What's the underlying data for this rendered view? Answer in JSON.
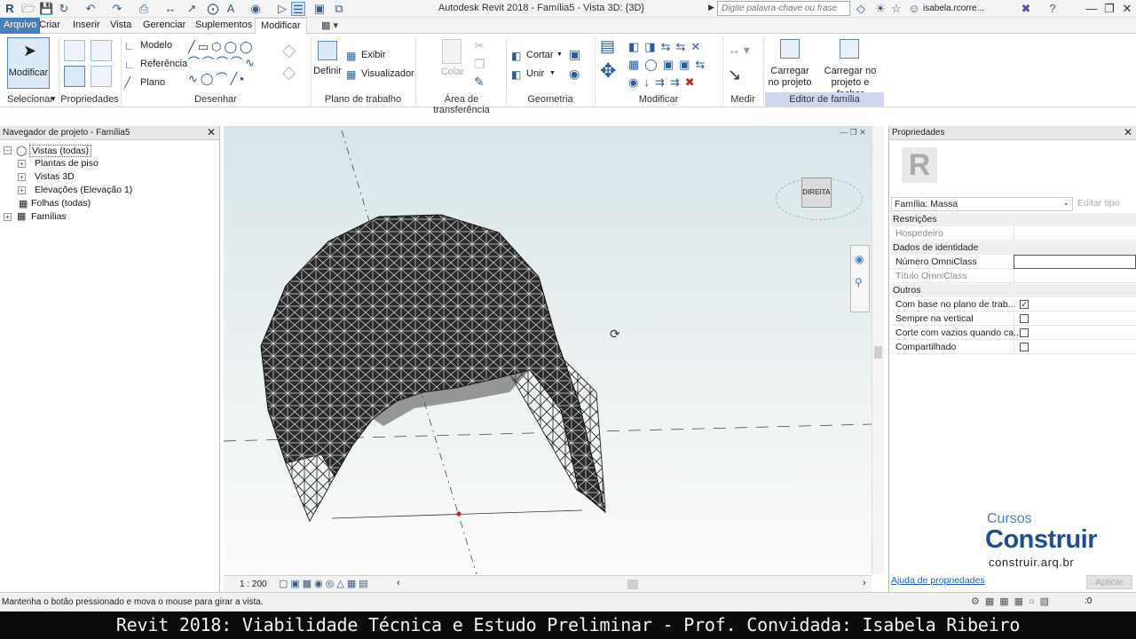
{
  "titlebar": {
    "app_title": "Autodesk Revit 2018 -   Família5 - Vista 3D: {3D}",
    "search_placeholder": "Digite palavra-chave ou frase",
    "user": "isabela.rcorre...",
    "logo": "R"
  },
  "tabs": [
    "Arquivo",
    "Criar",
    "Inserir",
    "Vista",
    "Gerenciar",
    "Suplementos",
    "Modificar"
  ],
  "active_tab": "Modificar",
  "ribbon": {
    "select_panel": {
      "button": "Modificar",
      "label": "Selecionar"
    },
    "properties_panel": {
      "label": "Propriedades"
    },
    "draw_panel": {
      "items": [
        "Modelo",
        "Referência",
        "Plano"
      ],
      "label": "Desenhar"
    },
    "work_plane_panel": {
      "define": "Definir",
      "show": "Exibir",
      "viewer": "Visualizador",
      "label": "Plano de trabalho"
    },
    "clipboard_panel": {
      "paste": "Colar",
      "label": "Área de transferência"
    },
    "geometry_panel": {
      "cut": "Cortar",
      "join": "Unir",
      "label": "Geometria"
    },
    "modify_panel": {
      "label": "Modificar"
    },
    "measure_panel": {
      "label": "Medir"
    },
    "family_editor_panel": {
      "load_project": "Carregar no projeto",
      "load_close": "Carregar no projeto e fechar",
      "label": "Editor de família"
    }
  },
  "browser": {
    "title": "Navegador de projeto - Família5",
    "items": [
      "Vistas (todas)",
      "Plantas de piso",
      "Vistas 3D",
      "Elevações (Elevação 1)",
      "Folhas (todas)",
      "Famílias"
    ]
  },
  "viewport": {
    "viewcube_face": "DIREITA",
    "scale": "1 : 200"
  },
  "properties": {
    "title": "Propriedades",
    "type_selector": "Família: Massa",
    "edit_type": "Editar tipo",
    "sections": {
      "restrictions": "Restrições",
      "identity": "Dados de identidade",
      "others": "Outros"
    },
    "rows": {
      "host": "Hospedeiro",
      "omniclass_number": "Número OmniClass",
      "omniclass_title": "Título OmniClass",
      "work_plane_based": "Com base no plano de trab...",
      "always_vertical": "Sempre na vertical",
      "cut_with_voids": "Corte com vazios quando ca...",
      "shared": "Compartilhado"
    },
    "checks": {
      "work_plane_based": "✓"
    },
    "help_link": "Ajuda de propriedades",
    "apply": "Aplicar"
  },
  "statusbar": {
    "message": "Mantenha o botão pressionado e mova o mouse para girar a vista.",
    "filter_count": ":0"
  },
  "banner": "Revit 2018: Viabilidade Técnica e Estudo Preliminar - Prof. Convidada: Isabela Ribeiro",
  "watermark": {
    "line1": "Cursos",
    "line2": "Construir",
    "line3": "construir.arq.br"
  }
}
